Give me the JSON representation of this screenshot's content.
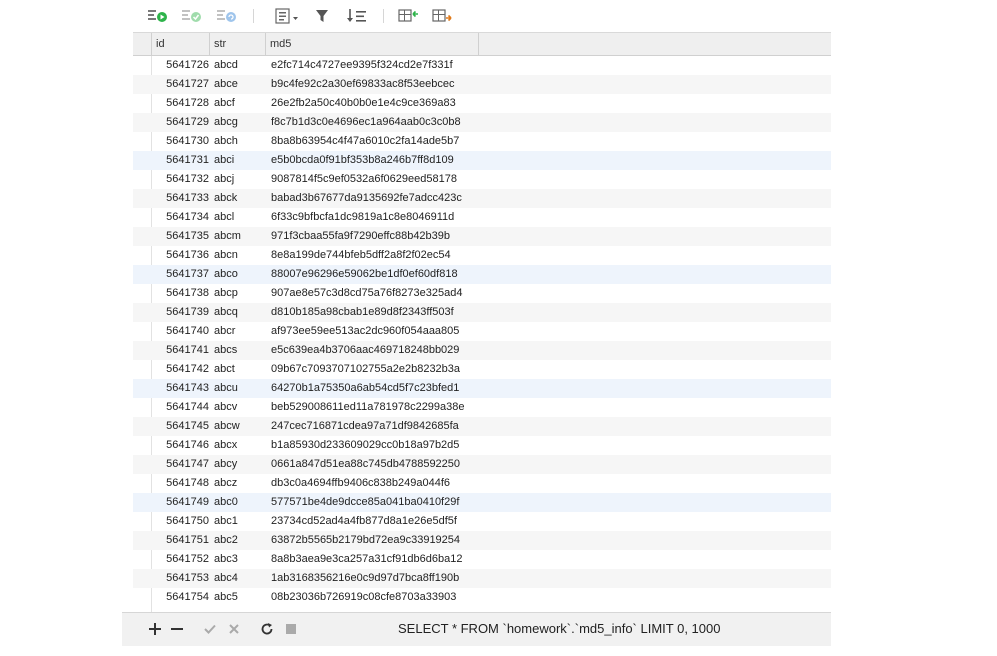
{
  "toolbar": {
    "icons": [
      "begin-transaction-icon",
      "commit-icon",
      "rollback-icon",
      "text-view-icon",
      "filter-icon",
      "sort-icon",
      "import-icon",
      "export-icon"
    ]
  },
  "columns": [
    "id",
    "str",
    "md5"
  ],
  "rows": [
    {
      "id": "5641726",
      "str": "abcd",
      "md5": "e2fc714c4727ee9395f324cd2e7f331f"
    },
    {
      "id": "5641727",
      "str": "abce",
      "md5": "b9c4fe92c2a30ef69833ac8f53eebcec"
    },
    {
      "id": "5641728",
      "str": "abcf",
      "md5": "26e2fb2a50c40b0b0e1e4c9ce369a83"
    },
    {
      "id": "5641729",
      "str": "abcg",
      "md5": "f8c7b1d3c0e4696ec1a964aab0c3c0b8"
    },
    {
      "id": "5641730",
      "str": "abch",
      "md5": "8ba8b63954c4f47a6010c2fa14ade5b7"
    },
    {
      "id": "5641731",
      "str": "abci",
      "md5": "e5b0bcda0f91bf353b8a246b7ff8d109"
    },
    {
      "id": "5641732",
      "str": "abcj",
      "md5": "9087814f5c9ef0532a6f0629eed58178"
    },
    {
      "id": "5641733",
      "str": "abck",
      "md5": "babad3b67677da9135692fe7adcc423c"
    },
    {
      "id": "5641734",
      "str": "abcl",
      "md5": "6f33c9bfbcfa1dc9819a1c8e8046911d"
    },
    {
      "id": "5641735",
      "str": "abcm",
      "md5": "971f3cbaa55fa9f7290effc88b42b39b"
    },
    {
      "id": "5641736",
      "str": "abcn",
      "md5": "8e8a199de744bfeb5dff2a8f2f02ec54"
    },
    {
      "id": "5641737",
      "str": "abco",
      "md5": "88007e96296e59062be1df0ef60df818"
    },
    {
      "id": "5641738",
      "str": "abcp",
      "md5": "907ae8e57c3d8cd75a76f8273e325ad4"
    },
    {
      "id": "5641739",
      "str": "abcq",
      "md5": "d810b185a98cbab1e89d8f2343ff503f"
    },
    {
      "id": "5641740",
      "str": "abcr",
      "md5": "af973ee59ee513ac2dc960f054aaa805"
    },
    {
      "id": "5641741",
      "str": "abcs",
      "md5": "e5c639ea4b3706aac469718248bb029"
    },
    {
      "id": "5641742",
      "str": "abct",
      "md5": "09b67c7093707102755a2e2b8232b3a"
    },
    {
      "id": "5641743",
      "str": "abcu",
      "md5": "64270b1a75350a6ab54cd5f7c23bfed1"
    },
    {
      "id": "5641744",
      "str": "abcv",
      "md5": "beb529008611ed11a781978c2299a38e"
    },
    {
      "id": "5641745",
      "str": "abcw",
      "md5": "247cec716871cdea97a71df9842685fa"
    },
    {
      "id": "5641746",
      "str": "abcx",
      "md5": "b1a85930d233609029cc0b18a97b2d5"
    },
    {
      "id": "5641747",
      "str": "abcy",
      "md5": "0661a847d51ea88c745db4788592250"
    },
    {
      "id": "5641748",
      "str": "abcz",
      "md5": "db3c0a4694ffb9406c838b249a044f6"
    },
    {
      "id": "5641749",
      "str": "abc0",
      "md5": "577571be4de9dcce85a041ba0410f29f"
    },
    {
      "id": "5641750",
      "str": "abc1",
      "md5": "23734cd52ad4a4fb877d8a1e26e5df5f"
    },
    {
      "id": "5641751",
      "str": "abc2",
      "md5": "63872b5565b2179bd72ea9c33919254"
    },
    {
      "id": "5641752",
      "str": "abc3",
      "md5": "8a8b3aea9e3ca257a31cf91db6d6ba12"
    },
    {
      "id": "5641753",
      "str": "abc4",
      "md5": "1ab3168356216e0c9d97d7bca8ff190b"
    },
    {
      "id": "5641754",
      "str": "abc5",
      "md5": "08b23036b726919c08cfe8703a33903"
    }
  ],
  "highlight_rows": [
    "5641731",
    "5641737",
    "5641743",
    "5641749"
  ],
  "statusbar": {
    "query": "SELECT * FROM `homework`.`md5_info` LIMIT 0, 1000"
  },
  "colors": {
    "accent_green": "#2eb34a",
    "row_blue": "#eef4fc"
  }
}
